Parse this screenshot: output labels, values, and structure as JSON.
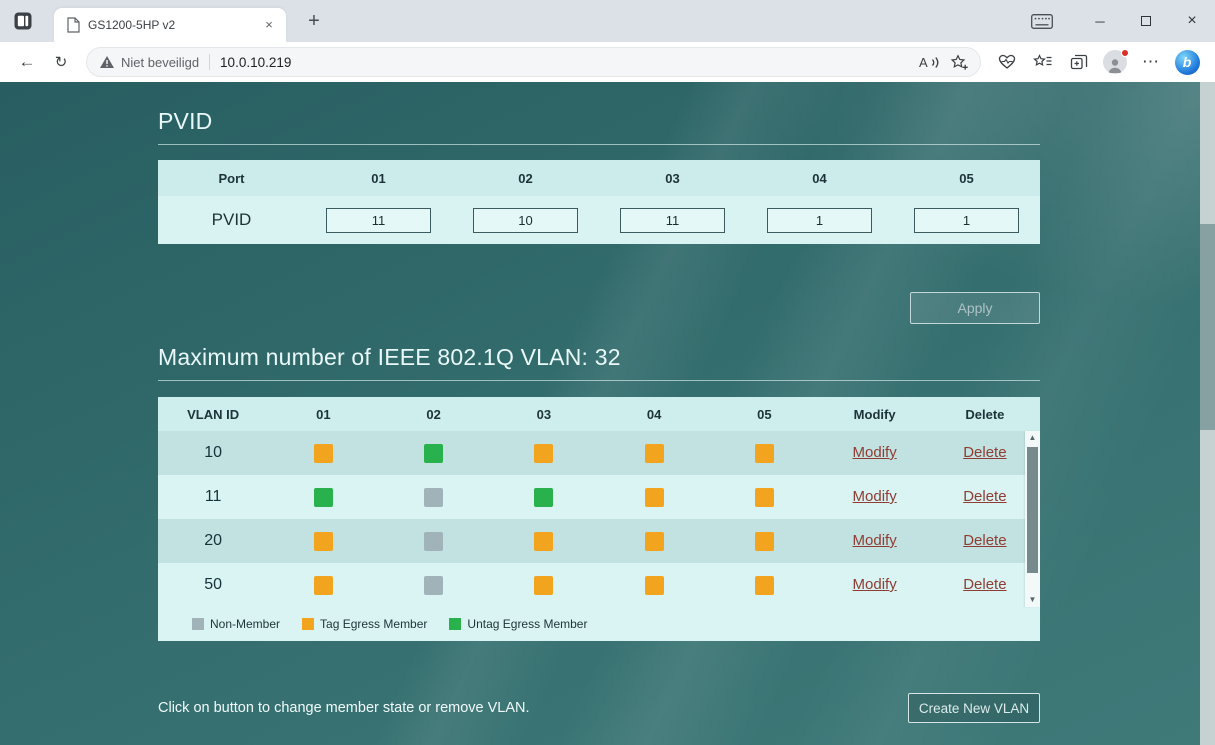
{
  "browser": {
    "tab_title": "GS1200-5HP v2",
    "security_label": "Niet beveiligd",
    "url": "10.0.10.219"
  },
  "icons": {
    "new_tab": "+",
    "tab_close": "×",
    "back": "←",
    "refresh": "↻",
    "minimize": "─",
    "close": "×",
    "more": "⋯",
    "scroll_up": "▲",
    "scroll_down": "▼",
    "bing": "b"
  },
  "pvid": {
    "title": "PVID",
    "headers": [
      "Port",
      "01",
      "02",
      "03",
      "04",
      "05"
    ],
    "row_label": "PVID",
    "values": [
      "11",
      "10",
      "11",
      "1",
      "1"
    ],
    "apply_label": "Apply"
  },
  "vlan": {
    "title": "Maximum number of IEEE 802.1Q VLAN: 32",
    "headers": [
      "VLAN ID",
      "01",
      "02",
      "03",
      "04",
      "05",
      "Modify",
      "Delete"
    ],
    "rows": [
      {
        "id": "10",
        "members": [
          "tag",
          "untag",
          "tag",
          "tag",
          "tag"
        ],
        "modify_label": "Modify",
        "delete_label": "Delete"
      },
      {
        "id": "11",
        "members": [
          "untag",
          "non",
          "untag",
          "tag",
          "tag"
        ],
        "modify_label": "Modify",
        "delete_label": "Delete"
      },
      {
        "id": "20",
        "members": [
          "tag",
          "non",
          "tag",
          "tag",
          "tag"
        ],
        "modify_label": "Modify",
        "delete_label": "Delete"
      },
      {
        "id": "50",
        "members": [
          "tag",
          "non",
          "tag",
          "tag",
          "tag"
        ],
        "modify_label": "Modify",
        "delete_label": "Delete"
      }
    ],
    "legend": [
      {
        "key": "non",
        "label": "Non-Member",
        "color": "#9fb3b9"
      },
      {
        "key": "tag",
        "label": "Tag Egress Member",
        "color": "#f2a41f"
      },
      {
        "key": "untag",
        "label": "Untag Egress Member",
        "color": "#28b14c"
      }
    ],
    "note": "Click on button to change member state or remove VLAN.",
    "create_label": "Create New VLAN"
  }
}
